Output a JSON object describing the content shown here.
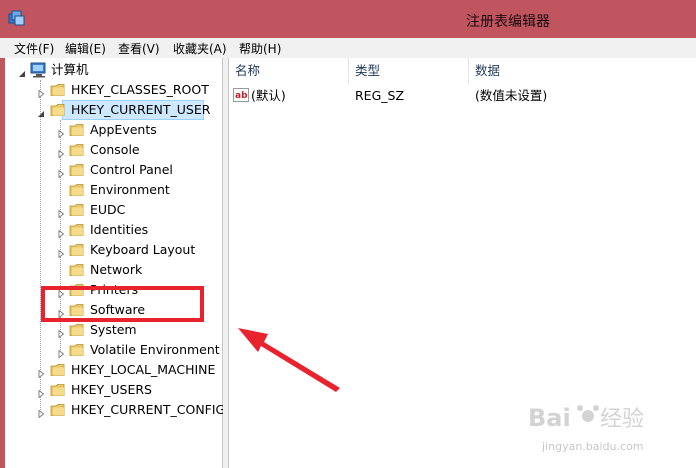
{
  "window": {
    "title": "注册表编辑器"
  },
  "menu": [
    "文件(F)",
    "编辑(E)",
    "查看(V)",
    "收藏夹(A)",
    "帮助(H)"
  ],
  "tree": {
    "root": "计算机",
    "hives": [
      "HKEY_CLASSES_ROOT",
      "HKEY_CURRENT_USER",
      "HKEY_LOCAL_MACHINE",
      "HKEY_USERS",
      "HKEY_CURRENT_CONFIG"
    ],
    "current_user_children": [
      "AppEvents",
      "Console",
      "Control Panel",
      "Environment",
      "EUDC",
      "Identities",
      "Keyboard Layout",
      "Network",
      "Printers",
      "Software",
      "System",
      "Volatile Environment"
    ],
    "selected": "HKEY_CURRENT_USER"
  },
  "list": {
    "columns": [
      "名称",
      "类型",
      "数据"
    ],
    "rows": [
      {
        "name": "(默认)",
        "type": "REG_SZ",
        "data": "(数值未设置)"
      }
    ]
  },
  "watermark": {
    "brand": "Baidu经验",
    "sub": "jingyan.baidu.com"
  },
  "colors": {
    "titlebar": "#c0545f",
    "selection": "#cde8ff",
    "highlight": "#e8232e",
    "folder": "#e9c767"
  }
}
